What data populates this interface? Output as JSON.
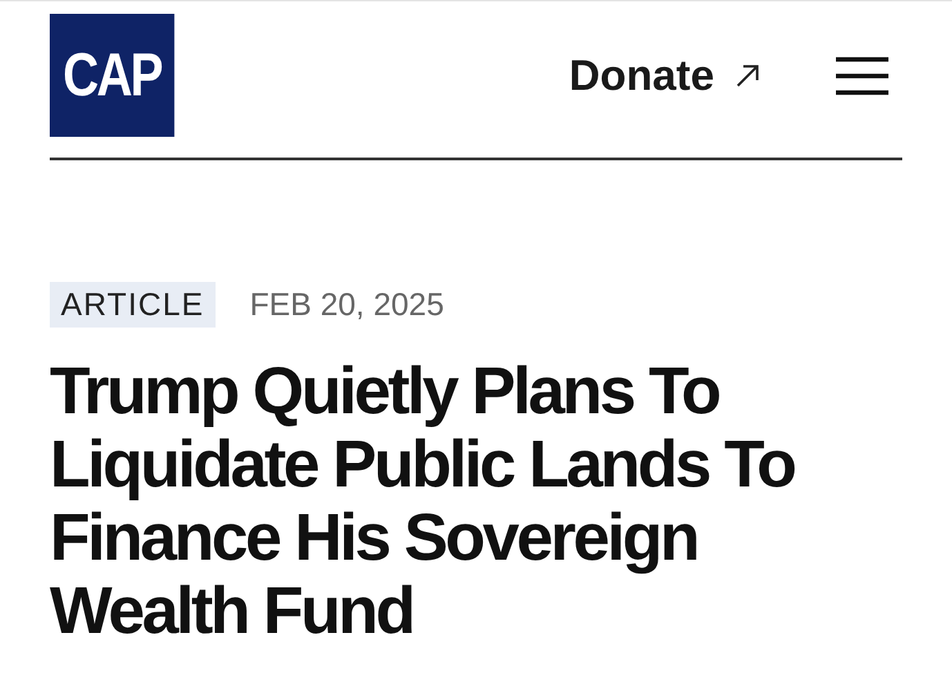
{
  "header": {
    "logo": "CAP",
    "donate": "Donate"
  },
  "article": {
    "type": "ARTICLE",
    "date": "FEB 20, 2025",
    "headline": "Trump Quietly Plans To Liquidate Public Lands To Finance His Sovereign Wealth Fund"
  }
}
